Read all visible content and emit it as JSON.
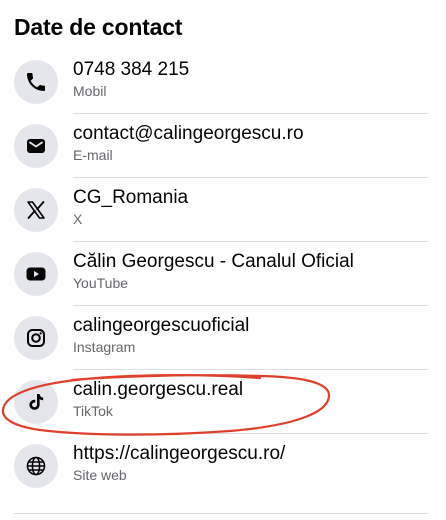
{
  "section": {
    "title": "Date de contact"
  },
  "contacts": [
    {
      "value": "0748 384 215",
      "label": "Mobil",
      "icon": "phone-icon"
    },
    {
      "value": "contact@calingeorgescu.ro",
      "label": "E-mail",
      "icon": "envelope-icon"
    },
    {
      "value": "CG_Romania",
      "label": "X",
      "icon": "x-logo-icon"
    },
    {
      "value": "Călin Georgescu - Canalul Oficial",
      "label": "YouTube",
      "icon": "youtube-icon"
    },
    {
      "value": "calingeorgescuoficial",
      "label": "Instagram",
      "icon": "instagram-icon"
    },
    {
      "value": "calin.georgescu.real",
      "label": "TikTok",
      "icon": "tiktok-icon"
    },
    {
      "value": "https://calingeorgescu.ro/",
      "label": "Site web",
      "icon": "globe-icon"
    }
  ],
  "colors": {
    "icon_background": "#e4e6eb",
    "primary_text": "#050505",
    "secondary_text": "#65676b",
    "annotation": "#e0412c"
  }
}
